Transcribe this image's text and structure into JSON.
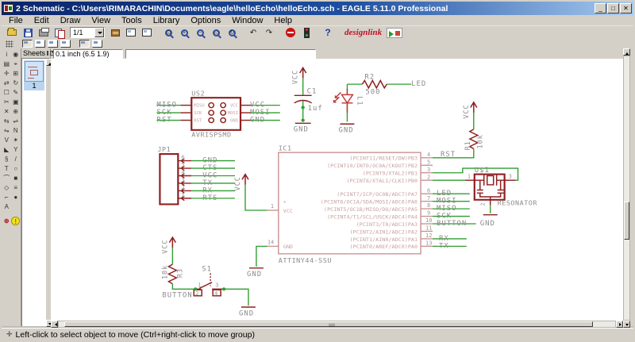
{
  "window": {
    "title": "2 Schematic - C:\\Users\\RIMARACHIN\\Documents\\eagle\\helloEcho\\helloEcho.sch - EAGLE 5.11.0 Professional",
    "minimize": "_",
    "maximize": "□",
    "close": "✕"
  },
  "menu": [
    "File",
    "Edit",
    "Draw",
    "View",
    "Tools",
    "Library",
    "Options",
    "Window",
    "Help"
  ],
  "toolbar": {
    "sheet_selector": "1/1",
    "designlink": "designlink",
    "zoom_in": "+",
    "zoom_out": "−",
    "zoom_fit": "⊡",
    "zoom_select": "▭",
    "zoom_redraw": "↻",
    "undo": "↶",
    "redo": "↷",
    "help": "?"
  },
  "coordbar": {
    "grid_readout": "0.1 inch (6.5 1.9)",
    "command": ""
  },
  "sheets": {
    "title": "Sheets",
    "close": "✕",
    "float": "❏",
    "sheet1_label": "1"
  },
  "status": {
    "marker": "✛",
    "message": "Left-click to select object to move (Ctrl+right-click to move group)"
  },
  "colors": {
    "net_green": "#2f9e2f",
    "symbol_dark_red": "#8e1f1f",
    "ic_rose": "#c98f8f",
    "label_gray": "#8c8c8c",
    "led_red": "#c33a3a"
  },
  "icons": {
    "info": "i",
    "show": "◉",
    "display": "▤",
    "mark": "⌖",
    "move": "✛",
    "copy": "⊞",
    "mirror": "⇄",
    "rotate": "↻",
    "group": "☐",
    "change": "✎",
    "cut": "✂",
    "paste": "▣",
    "delete": "✕",
    "add": "⊕",
    "pinswap": "⇆",
    "replace": "⇌",
    "gateswap": "⇋",
    "name": "N",
    "value": "V",
    "smash": "✶",
    "miter": "◣",
    "split": "Y",
    "invoke": "§",
    "wire": "/",
    "text": "T",
    "circle": "○",
    "arc": "⌒",
    "rect": "■",
    "polygon": "◇",
    "bus": "≡",
    "net": "⌐",
    "junction": "●",
    "label": "A",
    "erc": "⊕",
    "errors": "!"
  },
  "schematic": {
    "power": {
      "vcc": "VCC",
      "gnd": "GND"
    },
    "us2": {
      "name": "US2",
      "value": "AVRISPSMD",
      "pins_left": [
        "MISO",
        "SCK",
        "RST"
      ],
      "pins_right": [
        "VCC",
        "MOSI",
        "GND"
      ],
      "nets_left": [
        "MISO",
        "SCK",
        "RST"
      ],
      "nets_right": [
        "VCC",
        "MOSI",
        "GND"
      ]
    },
    "c1": {
      "name": "C1",
      "value": "1uf"
    },
    "r2": {
      "name": "R2",
      "value": "500",
      "net": "LED"
    },
    "led": {
      "name": "L1"
    },
    "r1": {
      "name": "R1",
      "value": "10k",
      "net": "RST"
    },
    "r3": {
      "name": "R3",
      "value": "10k",
      "net": "BUTTON"
    },
    "s1": {
      "name": "S1",
      "pin1": "1",
      "pin2": "2",
      "pin3": "3",
      "pin4": "4"
    },
    "resonator": {
      "name": "U$1",
      "value": "RESONATOR",
      "pin1": "1",
      "pin2": "2",
      "pin3": "3"
    },
    "jp1": {
      "name": "JP1",
      "pins": [
        {
          "num": "6",
          "net": "GND"
        },
        {
          "num": "5",
          "net": "CTS"
        },
        {
          "num": "4",
          "net": "VCC"
        },
        {
          "num": "3",
          "net": "TX"
        },
        {
          "num": "2",
          "net": "RX"
        },
        {
          "num": "1",
          "net": "RTS"
        }
      ]
    },
    "ic1": {
      "name": "IC1",
      "value": "ATTINY44-SSU",
      "vcc_pin": {
        "num": "1",
        "plus": "+",
        "label": "VCC"
      },
      "gnd_pin": {
        "num": "14",
        "label": "GND"
      },
      "right_pins": [
        {
          "num": "4",
          "label": "(PCINT11/RESET/DW)PB3",
          "net": "RST"
        },
        {
          "num": "5",
          "label": "(PCINT10/INT0/OC0A/CKOUT)PB2",
          "net": ""
        },
        {
          "num": "3",
          "label": "(PCINT9/XTAL2)PB1",
          "net": ""
        },
        {
          "num": "2",
          "label": "(PCINT8/XTAL1/CLKI)PB0",
          "net": ""
        },
        {
          "num": "6",
          "label": "(PCINT7/ICP/OC0B/ADC7)PA7",
          "net": "LED"
        },
        {
          "num": "7",
          "label": "(PCINT6/OC1A/SDA/MOSI/ADC6)PA6",
          "net": "MOSI"
        },
        {
          "num": "8",
          "label": "(PCINT5/OC1B/MISO/DO/ADC5)PA5",
          "net": "MISO"
        },
        {
          "num": "9",
          "label": "(PCINT4/T1/SCL/USCK/ADC4)PA4",
          "net": "SCK"
        },
        {
          "num": "10",
          "label": "(PCINT3/T0/ADC3)PA3",
          "net": "BUTTON"
        },
        {
          "num": "11",
          "label": "(PCINT2/AIN1/ADC2)PA2",
          "net": ""
        },
        {
          "num": "12",
          "label": "(PCINT1/AIN0/ADC1)PA1",
          "net": "RX"
        },
        {
          "num": "13",
          "label": "(PCINT0/AREF/ADC0)PA0",
          "net": "TX"
        }
      ]
    }
  }
}
